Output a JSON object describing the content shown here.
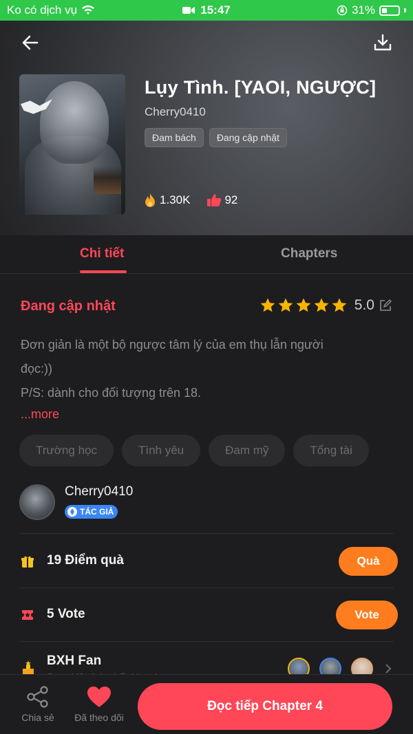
{
  "status_bar": {
    "carrier": "Ko có dịch vụ",
    "time": "15:47",
    "battery_percent": "31%"
  },
  "header": {
    "title": "Lụy Tình. [YAOI, NGƯỢC]",
    "author": "Cherry0410",
    "tags": [
      "Đam bách",
      "Đang cập nhật"
    ],
    "views": "1.30K",
    "likes": "92",
    "back_icon": "arrow-left-icon",
    "download_icon": "download-icon"
  },
  "tabs": {
    "detail": "Chi tiết",
    "chapters": "Chapters",
    "active": "detail"
  },
  "detail": {
    "status": "Đang cập nhật",
    "rating_value": "5.0",
    "rating_stars": 5,
    "description_lines": [
      "Đơn giản là một bộ ngược tâm lý của em thụ lẫn người",
      "đọc:))",
      "P/S: dành cho đối tượng trên 18."
    ],
    "more_label": "...more",
    "genres": [
      "Trường học",
      "Tình yêu",
      "Đam mỹ",
      "Tổng tài"
    ]
  },
  "author_card": {
    "name": "Cherry0410",
    "badge": "TÁC GIẢ"
  },
  "gift_row": {
    "label": "19 Điểm quà",
    "button": "Quà"
  },
  "vote_row": {
    "label": "5 Vote",
    "button": "Vote"
  },
  "fan_row": {
    "title": "BXH Fan",
    "subtitle": "Fan nhiệt tình nhất 30 ngày"
  },
  "bottom_bar": {
    "share_label": "Chia sẻ",
    "follow_label": "Đã theo dõi",
    "read_button": "Đọc tiếp Chapter 4"
  },
  "colors": {
    "accent": "#ff4757",
    "orange": "#ff7d1e",
    "status_bar": "#2fc84a",
    "background": "#1d1d1f"
  }
}
